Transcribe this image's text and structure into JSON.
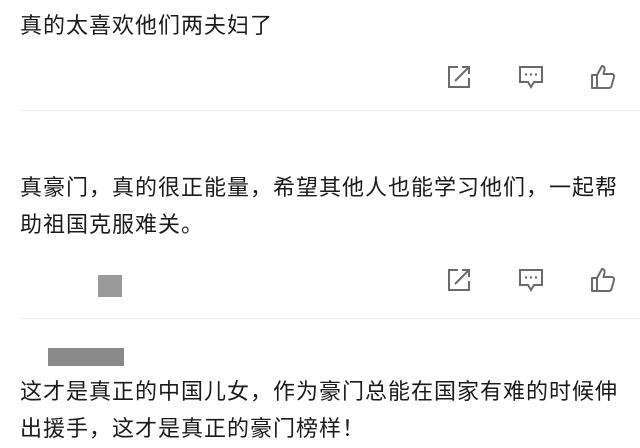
{
  "comments": [
    {
      "text": "真的太喜欢他们两夫妇了"
    },
    {
      "text": "真豪门，真的很正能量，希望其他人也能学习他们，一起帮助祖国克服难关。"
    },
    {
      "text": "这才是真正的中国儿女，作为豪门总能在国家有难的时候伸出援手，这才是真正的豪门榜样！"
    }
  ],
  "icons": {
    "share": "share-icon",
    "comment": "comment-icon",
    "like": "thumbs-up-icon"
  },
  "colors": {
    "icon": "#6b6b6b",
    "text": "#1a1a1a",
    "divider": "#ececec"
  }
}
